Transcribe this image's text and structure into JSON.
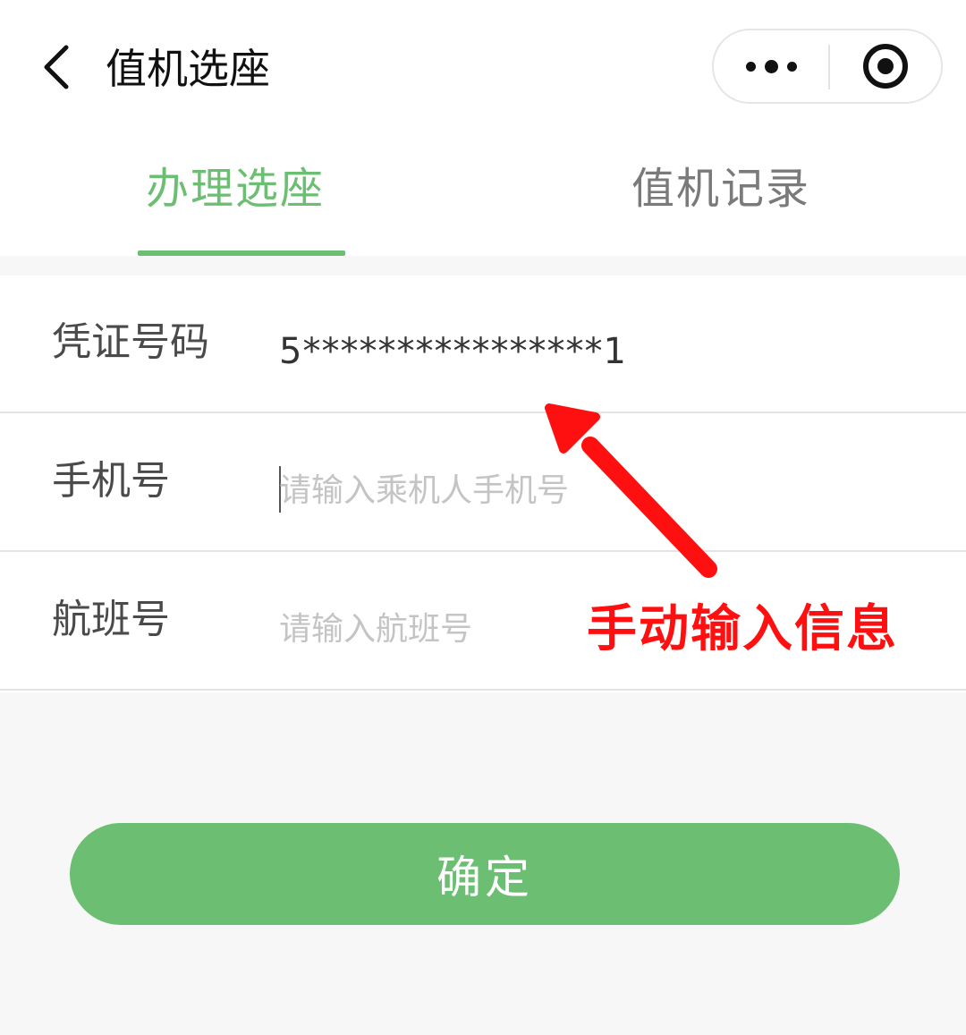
{
  "nav": {
    "title": "值机选座",
    "back_icon": "chevron-left-icon",
    "more_icon": "more-dots-icon",
    "close_icon": "target-circle-icon"
  },
  "tabs": [
    {
      "label": "办理选座",
      "active": true
    },
    {
      "label": "值机记录",
      "active": false
    }
  ],
  "form": {
    "fields": [
      {
        "label": "凭证号码",
        "value": "5****************1",
        "placeholder": ""
      },
      {
        "label": "手机号",
        "value": "",
        "placeholder": "请输入乘机人手机号"
      },
      {
        "label": "航班号",
        "value": "",
        "placeholder": "请输入航班号"
      }
    ]
  },
  "confirm_label": "确定",
  "annotation": {
    "text": "手动输入信息",
    "color": "#ff1010"
  },
  "colors": {
    "accent": "#6cbf72",
    "inactive_tab": "#7a7a7a",
    "background": "#f7f7f7"
  }
}
